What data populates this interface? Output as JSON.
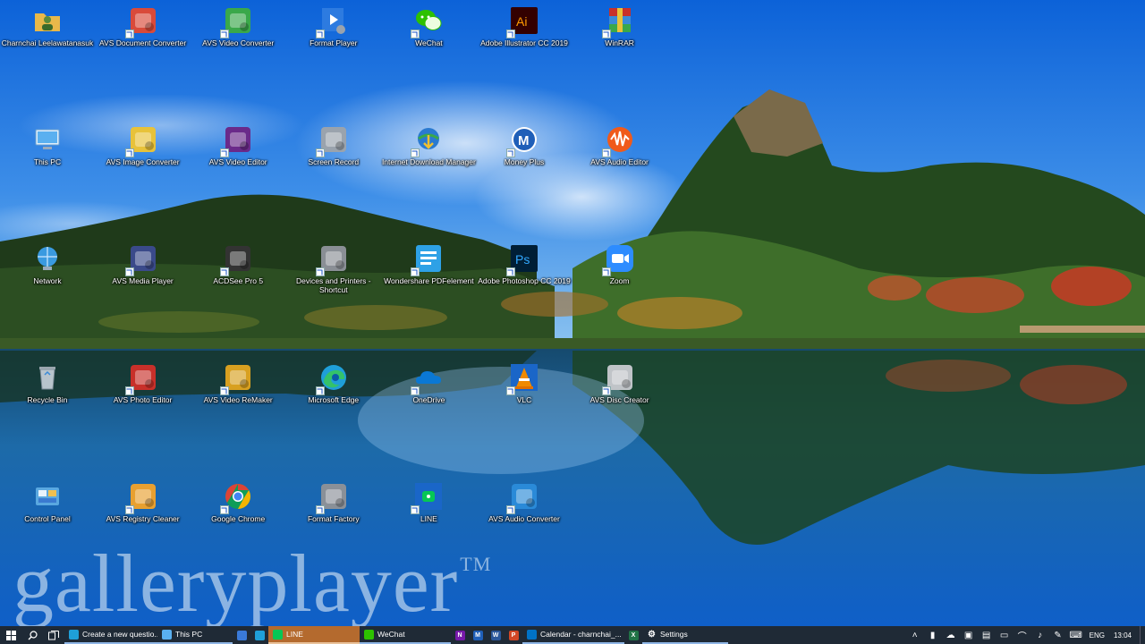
{
  "wallpaper": {
    "watermark": "galleryplayer",
    "trademark": "TM"
  },
  "desktop": {
    "icons": [
      {
        "label": "Charnchai Leelawatanasuk",
        "icon": "user-folder-icon",
        "color": "#e8b84a",
        "shortcut": false
      },
      {
        "label": "AVS Document Converter",
        "icon": "avs-document-converter-icon",
        "color": "#d94a3a",
        "shortcut": true
      },
      {
        "label": "AVS Video Converter",
        "icon": "avs-video-converter-icon",
        "color": "#3aa84a",
        "shortcut": true
      },
      {
        "label": "Format Player",
        "icon": "format-player-icon",
        "color": "#2d7be0",
        "shortcut": true
      },
      {
        "label": "WeChat",
        "icon": "wechat-icon",
        "color": "#2dc100",
        "shortcut": true
      },
      {
        "label": "Adobe Illustrator CC 2019",
        "icon": "illustrator-icon",
        "color": "#ff9a00",
        "shortcut": true
      },
      {
        "label": "WinRAR",
        "icon": "winrar-icon",
        "color": "#8b3a8b",
        "shortcut": true
      },
      {
        "label": "This PC",
        "icon": "computer-icon",
        "color": "#5ab0f0",
        "shortcut": false
      },
      {
        "label": "AVS Image Converter",
        "icon": "avs-image-converter-icon",
        "color": "#e8c23a",
        "shortcut": true
      },
      {
        "label": "AVS Video Editor",
        "icon": "avs-video-editor-icon",
        "color": "#6a2a8a",
        "shortcut": true
      },
      {
        "label": "Screen Record",
        "icon": "screen-record-icon",
        "color": "#9aa3ad",
        "shortcut": true
      },
      {
        "label": "Internet Download Manager",
        "icon": "idm-icon",
        "color": "#3aa84a",
        "shortcut": true
      },
      {
        "label": "Money Plus",
        "icon": "money-plus-icon",
        "color": "#1f5fb8",
        "shortcut": true
      },
      {
        "label": "AVS Audio Editor",
        "icon": "avs-audio-editor-icon",
        "color": "#f05a1a",
        "shortcut": true
      },
      {
        "label": "Network",
        "icon": "network-icon",
        "color": "#3a9ae0",
        "shortcut": false
      },
      {
        "label": "AVS Media Player",
        "icon": "avs-media-player-icon",
        "color": "#3a4a8a",
        "shortcut": true
      },
      {
        "label": "ACDSee Pro 5",
        "icon": "acdsee-icon",
        "color": "#333333",
        "shortcut": true
      },
      {
        "label": "Devices and Printers - Shortcut",
        "icon": "printer-icon",
        "color": "#8a8f95",
        "shortcut": true
      },
      {
        "label": "Wondershare PDFelement",
        "icon": "pdfelement-icon",
        "color": "#2ea1e6",
        "shortcut": true
      },
      {
        "label": "Adobe Photoshop CC 2019",
        "icon": "photoshop-icon",
        "color": "#31a8ff",
        "shortcut": true
      },
      {
        "label": "Zoom",
        "icon": "zoom-icon",
        "color": "#2d8cff",
        "shortcut": true
      },
      {
        "label": "Recycle Bin",
        "icon": "recycle-bin-icon",
        "color": "#b8c4cc",
        "shortcut": false
      },
      {
        "label": "AVS Photo Editor",
        "icon": "avs-photo-editor-icon",
        "color": "#c8302a",
        "shortcut": true
      },
      {
        "label": "AVS Video ReMaker",
        "icon": "avs-video-remaker-icon",
        "color": "#d8a020",
        "shortcut": true
      },
      {
        "label": "Microsoft Edge",
        "icon": "edge-icon",
        "color": "#1f9fd8",
        "shortcut": true
      },
      {
        "label": "OneDrive",
        "icon": "onedrive-icon",
        "color": "#0a78d4",
        "shortcut": true
      },
      {
        "label": "VLC",
        "icon": "vlc-icon",
        "color": "#f08a00",
        "shortcut": true
      },
      {
        "label": "AVS Disc Creator",
        "icon": "avs-disc-creator-icon",
        "color": "#c0c4c8",
        "shortcut": true
      },
      {
        "label": "Control Panel",
        "icon": "control-panel-icon",
        "color": "#5aa8e0",
        "shortcut": false
      },
      {
        "label": "AVS Registry Cleaner",
        "icon": "avs-registry-cleaner-icon",
        "color": "#e8a030",
        "shortcut": true
      },
      {
        "label": "Google Chrome",
        "icon": "chrome-icon",
        "color": "#db4437",
        "shortcut": true
      },
      {
        "label": "Format Factory",
        "icon": "format-factory-icon",
        "color": "#8a9098",
        "shortcut": true
      },
      {
        "label": "LINE",
        "icon": "line-icon",
        "color": "#06c755",
        "shortcut": true
      },
      {
        "label": "AVS Audio Converter",
        "icon": "avs-audio-converter-icon",
        "color": "#2a8ad8",
        "shortcut": true
      }
    ]
  },
  "taskbar": {
    "start_icon": "windows-start-icon",
    "search_icon": "search-icon",
    "taskview_icon": "task-view-icon",
    "apps": [
      {
        "label": "Create a new questio...",
        "icon": "chrome-icon",
        "color": "#1f9fd8",
        "state": "running"
      },
      {
        "label": "This PC",
        "icon": "file-explorer-icon",
        "color": "#5ab0f0",
        "state": "running"
      },
      {
        "label": "",
        "icon": "taskbar-app-icon",
        "color": "#3a7ad8",
        "state": "pinned"
      },
      {
        "label": "",
        "icon": "phone-icon",
        "color": "#1f9fd8",
        "state": "pinned"
      },
      {
        "label": "LINE",
        "icon": "line-icon",
        "color": "#06c755",
        "state": "highlight"
      },
      {
        "label": "WeChat",
        "icon": "wechat-icon",
        "color": "#2dc100",
        "state": "running"
      },
      {
        "label": "",
        "icon": "onenote-icon",
        "color": "#7719aa",
        "glyph": "N",
        "state": "pinned"
      },
      {
        "label": "",
        "icon": "money-plus-icon",
        "color": "#1f5fb8",
        "glyph": "M",
        "state": "pinned"
      },
      {
        "label": "",
        "icon": "word-icon",
        "color": "#2b579a",
        "glyph": "W",
        "state": "pinned"
      },
      {
        "label": "",
        "icon": "powerpoint-icon",
        "color": "#d24726",
        "glyph": "P",
        "state": "pinned"
      },
      {
        "label": "Calendar - charnchai_...",
        "icon": "outlook-icon",
        "color": "#0072c6",
        "state": "running"
      },
      {
        "label": "",
        "icon": "excel-icon",
        "color": "#217346",
        "glyph": "X",
        "state": "pinned"
      },
      {
        "label": "Settings",
        "icon": "settings-icon",
        "color": "#1f2a36",
        "state": "running"
      }
    ],
    "tray": {
      "icons": [
        "chevron-up-icon",
        "usb-icon",
        "cloud-icon",
        "video-icon",
        "network-icon",
        "display-icon",
        "wifi-icon",
        "volume-icon",
        "pen-icon",
        "keyboard-icon"
      ],
      "language": "ENG",
      "time": "13:04"
    }
  }
}
